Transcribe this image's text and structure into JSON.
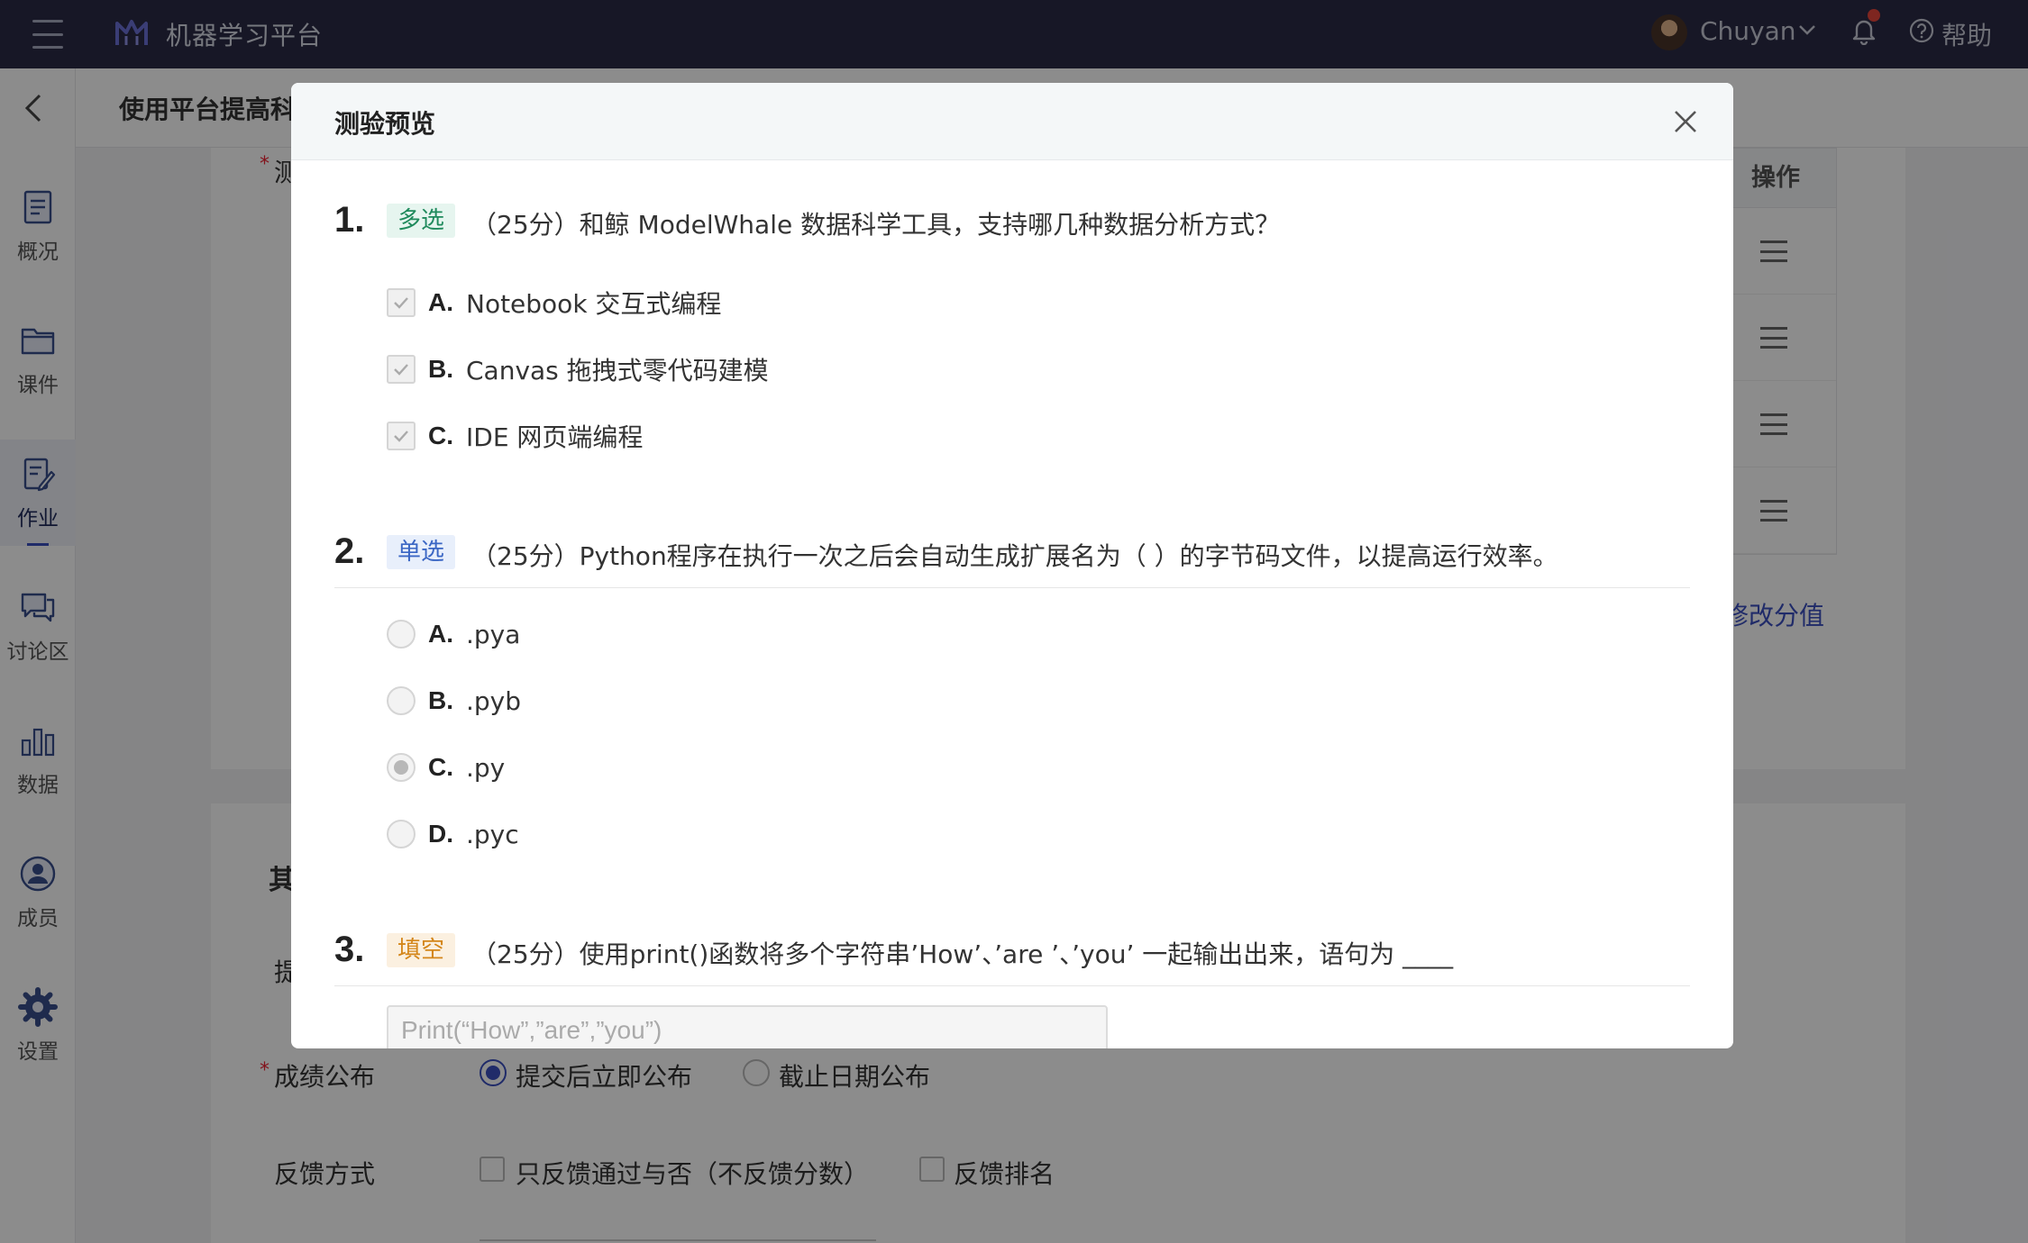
{
  "topbar": {
    "app_title": "机器学习平台",
    "user_name": "Chuyan",
    "help_label": "帮助",
    "brand_color": "#2a2a45",
    "notification_dot_color": "#e6453b"
  },
  "sidebar": {
    "items": [
      {
        "label": "概况",
        "icon": "overview-icon"
      },
      {
        "label": "课件",
        "icon": "folder-icon"
      },
      {
        "label": "作业",
        "icon": "assignment-icon",
        "active": true
      },
      {
        "label": "讨论区",
        "icon": "discussion-icon"
      },
      {
        "label": "数据",
        "icon": "data-icon"
      },
      {
        "label": "成员",
        "icon": "member-icon"
      },
      {
        "label": "设置",
        "icon": "gear-icon"
      }
    ]
  },
  "background_page": {
    "title": "使用平台提高科",
    "field_fragment": "测",
    "table_header": "操作",
    "edit_score_link": "修改分值",
    "section_title": "其",
    "label_fragment": "提",
    "grade_publish": {
      "label": "成绩公布",
      "options": [
        "提交后立即公布",
        "截止日期公布"
      ],
      "selected": 0
    },
    "feedback": {
      "label": "反馈方式",
      "options": [
        "只反馈通过与否（不反馈分数）",
        "反馈排名"
      ]
    }
  },
  "modal": {
    "title": "测验预览",
    "questions": [
      {
        "number": "1.",
        "tag": "多选",
        "text": "（25分）和鲸 ModelWhale 数据科学工具，支持哪几种数据分析方式？",
        "options": [
          {
            "letter": "A.",
            "text": "Notebook 交互式编程",
            "checked": true
          },
          {
            "letter": "B.",
            "text": "Canvas 拖拽式零代码建模",
            "checked": true
          },
          {
            "letter": "C.",
            "text": "IDE 网页端编程",
            "checked": true
          }
        ]
      },
      {
        "number": "2.",
        "tag": "单选",
        "text": "（25分）Python程序在执行一次之后会自动生成扩展名为（ ）的字节码文件，以提高运行效率。",
        "options": [
          {
            "letter": "A.",
            "text": ".pya"
          },
          {
            "letter": "B.",
            "text": ".pyb"
          },
          {
            "letter": "C.",
            "text": ".py",
            "selected": true
          },
          {
            "letter": "D.",
            "text": ".pyc"
          }
        ]
      },
      {
        "number": "3.",
        "tag": "填空",
        "text": "（25分）使用print()函数将多个字符串’How’、’are ’、’you’ 一起输出出来，语句为 ____",
        "answer_placeholder": "Print(“How”,”are”,”you”)"
      }
    ]
  }
}
